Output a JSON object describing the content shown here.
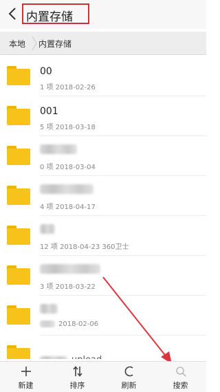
{
  "header": {
    "title": "内置存储",
    "back_icon": "back-arrow-icon",
    "highlight_color": "#c8323a"
  },
  "breadcrumb": {
    "root": "本地",
    "current": "内置存储"
  },
  "files": [
    {
      "name": "00",
      "meta": "1 项  2018-02-26"
    },
    {
      "name": "001",
      "meta": "5 项  2018-03-18"
    },
    {
      "name": "",
      "meta": "0 项  2018-03-04",
      "name_blurred": true
    },
    {
      "name": "",
      "meta": "4 项  2018-04-17",
      "name_blurred": true
    },
    {
      "name": "",
      "meta": "12 项  2018-04-23  360卫士",
      "name_blurred": true
    },
    {
      "name": "",
      "meta": "3 项  2018-03-22",
      "name_blurred": true
    },
    {
      "name": "",
      "meta": "2018-02-06",
      "name_blurred": true,
      "meta_partly_blurred": true
    },
    {
      "name": "upload",
      "meta": "",
      "name_blurred": true
    }
  ],
  "folder_color": "#f7c21a",
  "toolbar": [
    {
      "label": "新建",
      "icon": "plus-icon"
    },
    {
      "label": "排序",
      "icon": "sort-icon"
    },
    {
      "label": "刷新",
      "icon": "refresh-icon"
    },
    {
      "label": "搜索",
      "icon": "search-icon"
    }
  ],
  "annotation_arrow_color": "#d9363e"
}
